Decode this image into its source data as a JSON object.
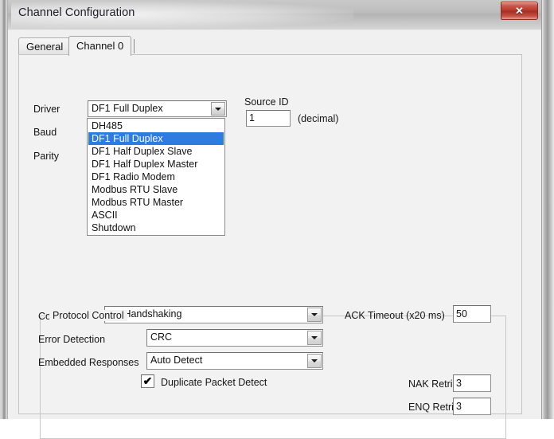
{
  "window": {
    "title": "Channel Configuration",
    "close_label": "✕",
    "close_icon": "close-icon"
  },
  "tabs": [
    {
      "label": "General",
      "active": false
    },
    {
      "label": "Channel 0",
      "active": true
    }
  ],
  "channel_page": {
    "labels": {
      "driver": "Driver",
      "baud": "Baud",
      "parity": "Parity",
      "source_id": "Source ID",
      "decimal_note": "(decimal)"
    },
    "driver_combo": {
      "value": "DF1 Full Duplex",
      "open": true,
      "options": [
        "DH485",
        "DF1 Full Duplex",
        "DF1 Half Duplex Slave",
        "DF1 Half Duplex Master",
        "DF1 Radio Modem",
        "Modbus RTU Slave",
        "Modbus RTU Master",
        "ASCII",
        "Shutdown"
      ],
      "selected_index": 1
    },
    "source_id": {
      "value": "1"
    }
  },
  "protocol_control": {
    "title": "Protocol Control",
    "control_line": {
      "label": "Control Line",
      "value": "No Handshaking"
    },
    "error_detection": {
      "label": "Error Detection",
      "value": "CRC"
    },
    "embedded_responses": {
      "label": "Embedded Responses",
      "value": "Auto Detect"
    },
    "duplicate_packet_detect": {
      "label": "Duplicate Packet Detect",
      "checked": true,
      "check_glyph": "✔"
    },
    "ack_timeout": {
      "label": "ACK Timeout (x20 ms)",
      "value": "50"
    },
    "nak_retries": {
      "label": "NAK Retries",
      "value": "3"
    },
    "enq_retries": {
      "label": "ENQ Retries",
      "value": "3"
    }
  },
  "colors": {
    "selection_blue": "#2f7ce0",
    "close_red": "#b5372b",
    "dialog_face": "#f0f0f0",
    "tabpage_face": "#f2f2f2"
  }
}
